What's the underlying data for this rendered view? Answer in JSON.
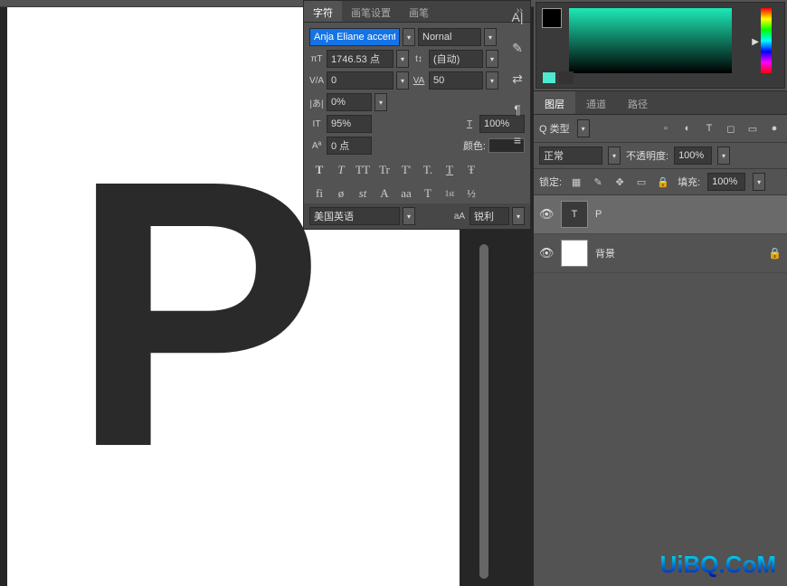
{
  "canvas": {
    "letter": "P"
  },
  "charPanel": {
    "tabs": {
      "character": "字符",
      "paragraphSettings": "画笔设置",
      "brush": "画笔",
      "close": "››"
    },
    "font": "Anja Eliane accent",
    "fontStyle": "Nornal",
    "size": "1746.53 点",
    "leading": "(自动)",
    "tracking": "0",
    "kerning": "50",
    "vScale": "0%",
    "hScalePct": "95%",
    "wScalePct": "100%",
    "baseline": "0 点",
    "colorLabel": "颜色:",
    "styles": [
      "T",
      "T",
      "TT",
      "Tr",
      "T'",
      "T.",
      "T",
      "Ŧ"
    ],
    "ot": [
      "fi",
      "ø",
      "st",
      "A",
      "aa",
      "T",
      "1st",
      "½"
    ],
    "language": "美国英语",
    "aa": "aA",
    "antiAlias": "锐利"
  },
  "sidebar": [
    "A|",
    "✎",
    "⇄",
    "¶",
    "≡"
  ],
  "colorPicker": {},
  "layersPanel": {
    "tabs": {
      "layers": "图层",
      "channels": "通道",
      "paths": "路径"
    },
    "filterLabel": "Q 类型",
    "blendMode": "正常",
    "opacityLabel": "不透明度:",
    "opacity": "100%",
    "lockLabel": "锁定:",
    "fillLabel": "填充:",
    "fill": "100%",
    "layers": [
      {
        "name": "P",
        "type": "T",
        "selected": true
      },
      {
        "name": "背景",
        "type": "bg",
        "locked": true
      }
    ]
  },
  "watermark": "UiBQ.CoM"
}
